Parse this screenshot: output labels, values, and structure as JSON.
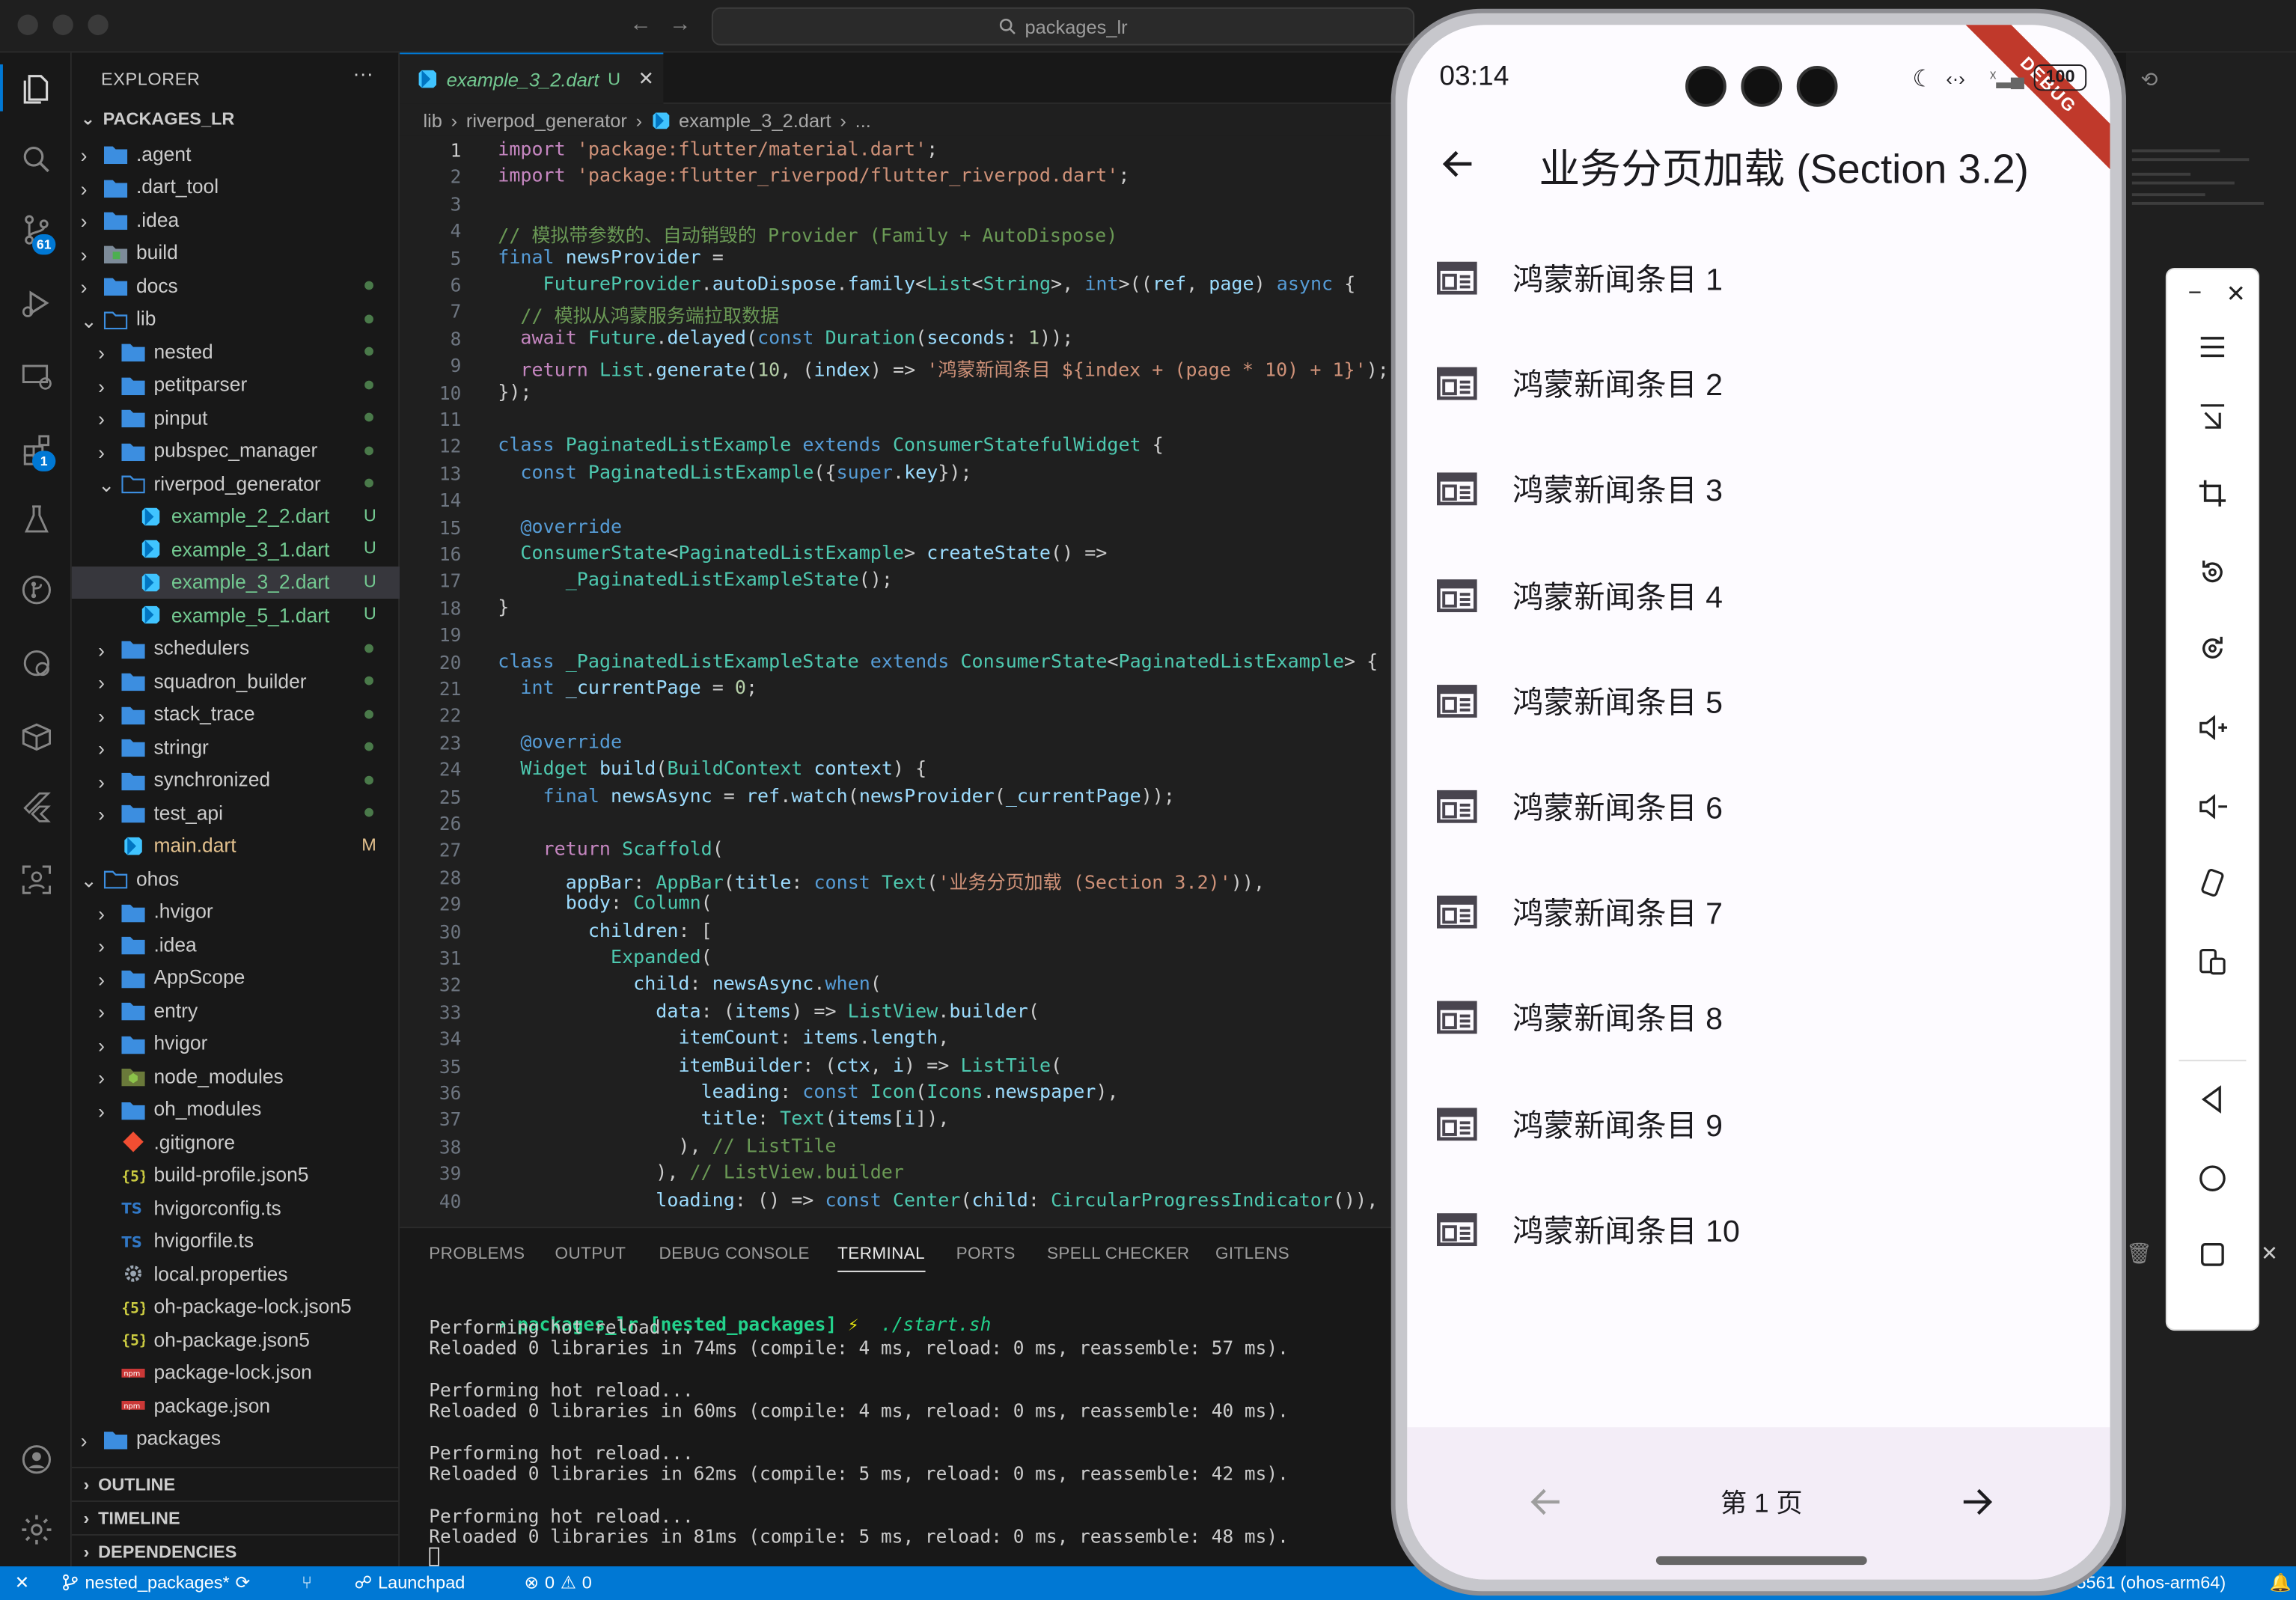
{
  "window": {
    "search_text": "packages_lr"
  },
  "activity_bar": {
    "scm_badge": "61",
    "extensions_badge": "1"
  },
  "explorer": {
    "title": "EXPLORER",
    "more": "···",
    "root": "PACKAGES_LR",
    "items": [
      {
        "label": ".agent",
        "depth": 1,
        "type": "folder",
        "open": false
      },
      {
        "label": ".dart_tool",
        "depth": 1,
        "type": "folder",
        "open": false
      },
      {
        "label": ".idea",
        "depth": 1,
        "type": "folder",
        "open": false
      },
      {
        "label": "build",
        "depth": 1,
        "type": "folder-build",
        "open": false
      },
      {
        "label": "docs",
        "depth": 1,
        "type": "folder",
        "open": false,
        "dot": true
      },
      {
        "label": "lib",
        "depth": 1,
        "type": "folder",
        "open": true,
        "dot": true
      },
      {
        "label": "nested",
        "depth": 2,
        "type": "folder",
        "open": false,
        "dot": true
      },
      {
        "label": "petitparser",
        "depth": 2,
        "type": "folder",
        "open": false,
        "dot": true
      },
      {
        "label": "pinput",
        "depth": 2,
        "type": "folder",
        "open": false,
        "dot": true
      },
      {
        "label": "pubspec_manager",
        "depth": 2,
        "type": "folder",
        "open": false,
        "dot": true
      },
      {
        "label": "riverpod_generator",
        "depth": 2,
        "type": "folder",
        "open": true,
        "dot": true
      },
      {
        "label": "example_2_2.dart",
        "depth": 3,
        "type": "dart",
        "status": "U"
      },
      {
        "label": "example_3_1.dart",
        "depth": 3,
        "type": "dart",
        "status": "U"
      },
      {
        "label": "example_3_2.dart",
        "depth": 3,
        "type": "dart",
        "status": "U",
        "selected": true
      },
      {
        "label": "example_5_1.dart",
        "depth": 3,
        "type": "dart",
        "status": "U"
      },
      {
        "label": "schedulers",
        "depth": 2,
        "type": "folder",
        "open": false,
        "dot": true
      },
      {
        "label": "squadron_builder",
        "depth": 2,
        "type": "folder",
        "open": false,
        "dot": true
      },
      {
        "label": "stack_trace",
        "depth": 2,
        "type": "folder",
        "open": false,
        "dot": true
      },
      {
        "label": "stringr",
        "depth": 2,
        "type": "folder",
        "open": false,
        "dot": true
      },
      {
        "label": "synchronized",
        "depth": 2,
        "type": "folder",
        "open": false,
        "dot": true
      },
      {
        "label": "test_api",
        "depth": 2,
        "type": "folder",
        "open": false,
        "dot": true
      },
      {
        "label": "main.dart",
        "depth": 2,
        "type": "dart",
        "status": "M",
        "nochev": true
      },
      {
        "label": "ohos",
        "depth": 1,
        "type": "folder",
        "open": true
      },
      {
        "label": ".hvigor",
        "depth": 2,
        "type": "folder",
        "open": false
      },
      {
        "label": ".idea",
        "depth": 2,
        "type": "folder",
        "open": false
      },
      {
        "label": "AppScope",
        "depth": 2,
        "type": "folder",
        "open": false
      },
      {
        "label": "entry",
        "depth": 2,
        "type": "folder",
        "open": false
      },
      {
        "label": "hvigor",
        "depth": 2,
        "type": "folder",
        "open": false
      },
      {
        "label": "node_modules",
        "depth": 2,
        "type": "folder-node",
        "open": false
      },
      {
        "label": "oh_modules",
        "depth": 2,
        "type": "folder",
        "open": false
      },
      {
        "label": ".gitignore",
        "depth": 2,
        "type": "git",
        "nochev": true
      },
      {
        "label": "build-profile.json5",
        "depth": 2,
        "type": "json",
        "nochev": true
      },
      {
        "label": "hvigorconfig.ts",
        "depth": 2,
        "type": "ts",
        "nochev": true
      },
      {
        "label": "hvigorfile.ts",
        "depth": 2,
        "type": "ts",
        "nochev": true
      },
      {
        "label": "local.properties",
        "depth": 2,
        "type": "gear",
        "nochev": true
      },
      {
        "label": "oh-package-lock.json5",
        "depth": 2,
        "type": "json",
        "nochev": true
      },
      {
        "label": "oh-package.json5",
        "depth": 2,
        "type": "json",
        "nochev": true
      },
      {
        "label": "package-lock.json",
        "depth": 2,
        "type": "npm",
        "nochev": true
      },
      {
        "label": "package.json",
        "depth": 2,
        "type": "npm",
        "nochev": true
      },
      {
        "label": "packages",
        "depth": 1,
        "type": "folder",
        "open": false
      }
    ],
    "sections": [
      "OUTLINE",
      "TIMELINE",
      "DEPENDENCIES"
    ]
  },
  "editor": {
    "tab_label": "example_3_2.dart",
    "tab_status": "U",
    "breadcrumb": [
      "lib",
      "riverpod_generator",
      "example_3_2.dart",
      "..."
    ],
    "lines": [
      "import 'package:flutter/material.dart';",
      "import 'package:flutter_riverpod/flutter_riverpod.dart';",
      "",
      "// 模拟带参数的、自动销毁的 Provider (Family + AutoDispose)",
      "final newsProvider =",
      "    FutureProvider.autoDispose.family<List<String>, int>((ref, page) async {",
      "  // 模拟从鸿蒙服务端拉取数据",
      "  await Future.delayed(const Duration(seconds: 1));",
      "  return List.generate(10, (index) => '鸿蒙新闻条目 ${index + (page * 10) + 1}');",
      "});",
      "",
      "class PaginatedListExample extends ConsumerStatefulWidget {",
      "  const PaginatedListExample({super.key});",
      "",
      "  @override",
      "  ConsumerState<PaginatedListExample> createState() =>",
      "      _PaginatedListExampleState();",
      "}",
      "",
      "class _PaginatedListExampleState extends ConsumerState<PaginatedListExample> {",
      "  int _currentPage = 0;",
      "",
      "  @override",
      "  Widget build(BuildContext context) {",
      "    final newsAsync = ref.watch(newsProvider(_currentPage));",
      "",
      "    return Scaffold(",
      "      appBar: AppBar(title: const Text('业务分页加载 (Section 3.2)')),",
      "      body: Column(",
      "        children: [",
      "          Expanded(",
      "            child: newsAsync.when(",
      "              data: (items) => ListView.builder(",
      "                itemCount: items.length,",
      "                itemBuilder: (ctx, i) => ListTile(",
      "                  leading: const Icon(Icons.newspaper),",
      "                  title: Text(items[i]),",
      "                ), // ListTile",
      "              ), // ListView.builder",
      "              loading: () => const Center(child: CircularProgressIndicator()),"
    ]
  },
  "panel": {
    "tabs": [
      "PROBLEMS",
      "OUTPUT",
      "DEBUG CONSOLE",
      "TERMINAL",
      "PORTS",
      "SPELL CHECKER",
      "GITLENS"
    ],
    "active_tab": "TERMINAL",
    "prompt_dir": "packages_lr",
    "prompt_branch": "[nested_packages]",
    "prompt_symbol": "⚡",
    "prompt_cmd": "./start.sh",
    "output": [
      "Performing hot reload...",
      "Reloaded 0 libraries in 74ms (compile: 4 ms, reload: 0 ms, reassemble: 57 ms).",
      "",
      "Performing hot reload...",
      "Reloaded 0 libraries in 60ms (compile: 4 ms, reload: 0 ms, reassemble: 40 ms).",
      "",
      "Performing hot reload...",
      "Reloaded 0 libraries in 62ms (compile: 5 ms, reload: 0 ms, reassemble: 42 ms).",
      "",
      "Performing hot reload...",
      "Reloaded 0 libraries in 81ms (compile: 5 ms, reload: 0 ms, reassemble: 48 ms)."
    ]
  },
  "status_bar": {
    "branch": "nested_packages*",
    "launchpad": "Launchpad",
    "errors": "0",
    "warnings": "0",
    "device": "5561 (ohos-arm64)"
  },
  "phone": {
    "time": "03:14",
    "battery": "100",
    "debug_banner": "DEBUG",
    "app_title": "业务分页加载 (Section 3.2)",
    "items": [
      "鸿蒙新闻条目 1",
      "鸿蒙新闻条目 2",
      "鸿蒙新闻条目 3",
      "鸿蒙新闻条目 4",
      "鸿蒙新闻条目 5",
      "鸿蒙新闻条目 6",
      "鸿蒙新闻条目 7",
      "鸿蒙新闻条目 8",
      "鸿蒙新闻条目 9",
      "鸿蒙新闻条目 10"
    ],
    "page_label": "第 1 页"
  }
}
